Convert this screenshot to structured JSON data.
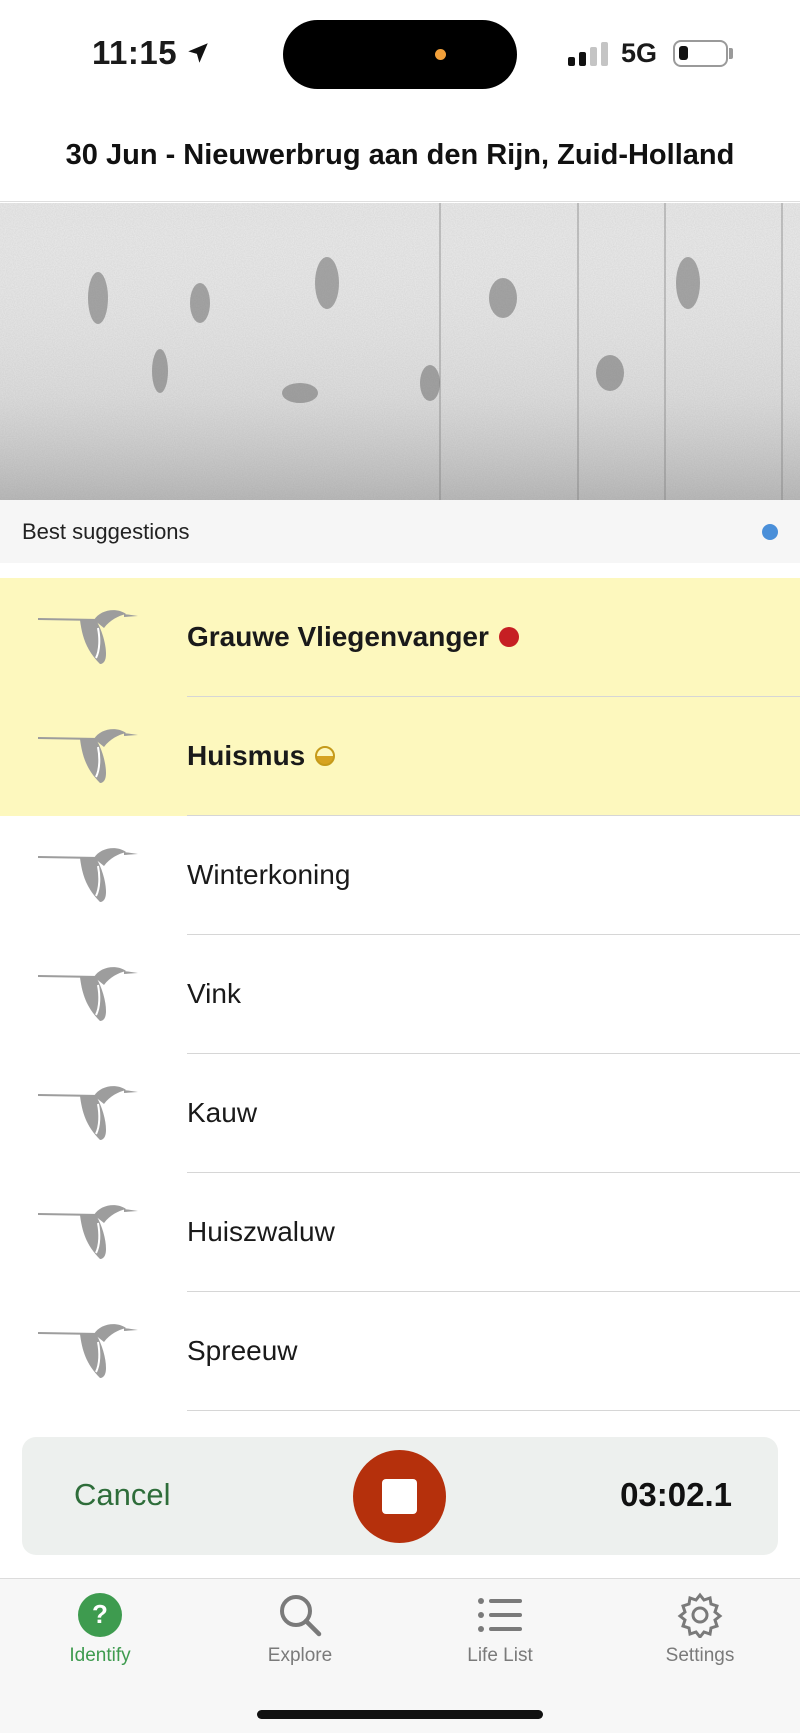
{
  "status_bar": {
    "time": "11:15",
    "network": "5G"
  },
  "header": {
    "title": "30 Jun - Nieuwerbrug aan den Rijn, Zuid-Holland"
  },
  "suggestions": {
    "label": "Best suggestions",
    "indicator_color": "#4a8fd9"
  },
  "species": [
    {
      "name": "Grauwe Vliegenvanger",
      "highlighted": true,
      "badge": "red-dot"
    },
    {
      "name": "Huismus",
      "highlighted": true,
      "badge": "half-circle"
    },
    {
      "name": "Winterkoning",
      "highlighted": false
    },
    {
      "name": "Vink",
      "highlighted": false
    },
    {
      "name": "Kauw",
      "highlighted": false
    },
    {
      "name": "Huiszwaluw",
      "highlighted": false
    },
    {
      "name": "Spreeuw",
      "highlighted": false
    }
  ],
  "recording": {
    "cancel_label": "Cancel",
    "elapsed": "03:02.1",
    "stop_color": "#b5300c"
  },
  "tabs": [
    {
      "label": "Identify",
      "icon": "question-circle-icon",
      "active": true
    },
    {
      "label": "Explore",
      "icon": "magnifier-icon",
      "active": false
    },
    {
      "label": "Life List",
      "icon": "list-icon",
      "active": false
    },
    {
      "label": "Settings",
      "icon": "gear-icon",
      "active": false
    }
  ],
  "colors": {
    "highlight": "#fdf8be",
    "accent_green": "#3e9b4f"
  }
}
